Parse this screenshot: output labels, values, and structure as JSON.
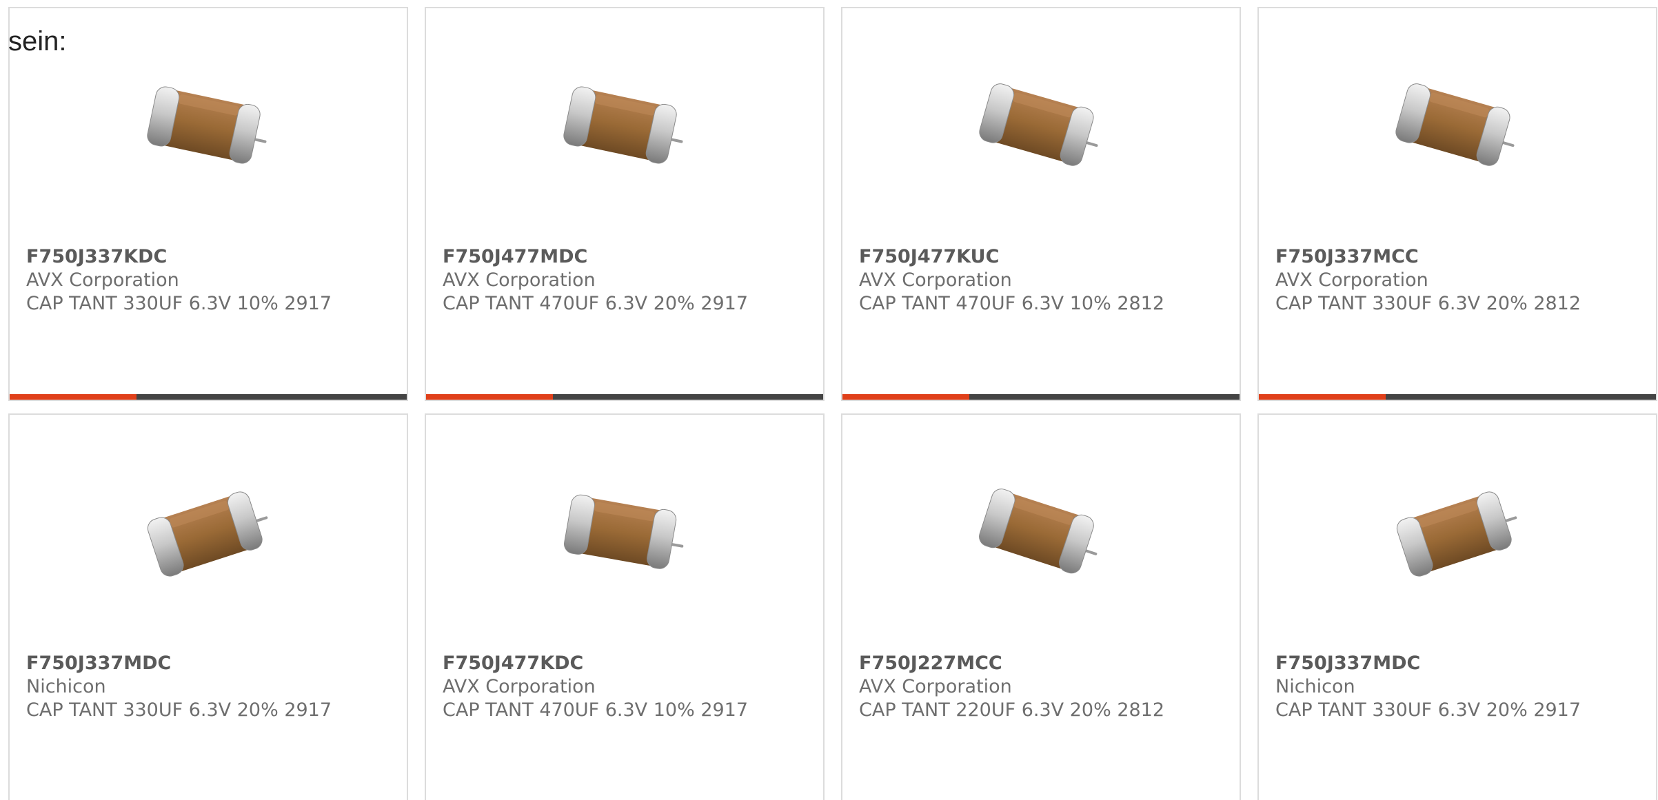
{
  "intro_text": "sein:",
  "colors": {
    "accent": "#e0401a",
    "bar_track": "#444444",
    "card_border": "#dcdcdc",
    "part_text": "#5a5a5a",
    "body_text": "#6e6e6e",
    "capacitor_body": "#9a6a36",
    "capacitor_cap": "#c8c8c8"
  },
  "progress_fraction": 0.32,
  "cards": [
    {
      "part_number": "F750J337KDC",
      "manufacturer": "AVX Corporation",
      "description": "CAP TANT 330UF 6.3V 10% 2917",
      "image_icon": "capacitor-icon"
    },
    {
      "part_number": "F750J477MDC",
      "manufacturer": "AVX Corporation",
      "description": "CAP TANT 470UF 6.3V 20% 2917",
      "image_icon": "capacitor-icon"
    },
    {
      "part_number": "F750J477KUC",
      "manufacturer": "AVX Corporation",
      "description": "CAP TANT 470UF 6.3V 10% 2812",
      "image_icon": "capacitor-icon"
    },
    {
      "part_number": "F750J337MCC",
      "manufacturer": "AVX Corporation",
      "description": "CAP TANT 330UF 6.3V 20% 2812",
      "image_icon": "capacitor-icon"
    },
    {
      "part_number": "F750J337MDC",
      "manufacturer": "Nichicon",
      "description": "CAP TANT 330UF 6.3V 20% 2917",
      "image_icon": "capacitor-icon"
    },
    {
      "part_number": "F750J477KDC",
      "manufacturer": "AVX Corporation",
      "description": "CAP TANT 470UF 6.3V 10% 2917",
      "image_icon": "capacitor-icon"
    },
    {
      "part_number": "F750J227MCC",
      "manufacturer": "AVX Corporation",
      "description": "CAP TANT 220UF 6.3V 20% 2812",
      "image_icon": "capacitor-icon"
    },
    {
      "part_number": "F750J337MDC",
      "manufacturer": "Nichicon",
      "description": "CAP TANT 330UF 6.3V 20% 2917",
      "image_icon": "capacitor-icon"
    }
  ]
}
